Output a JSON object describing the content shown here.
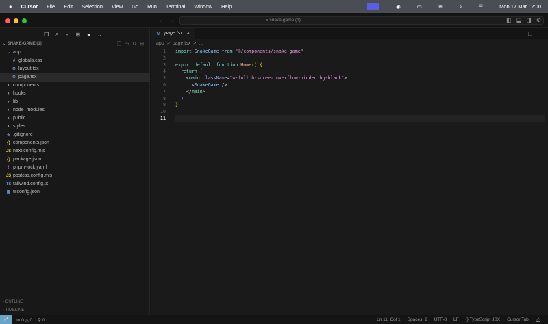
{
  "menubar": {
    "app": "Cursor",
    "items": [
      "File",
      "Edit",
      "Selection",
      "View",
      "Go",
      "Run",
      "Terminal",
      "Window",
      "Help"
    ],
    "datetime": "Mon 17 Mar  12:00"
  },
  "window": {
    "search": "snake-game (1)"
  },
  "sidebar": {
    "title": "SNAKE-GAME (1)",
    "tree": [
      {
        "label": "app",
        "icon": "⌄",
        "indent": 1
      },
      {
        "label": "globals.css",
        "icon": "#",
        "indent": 2,
        "color": "#7fa4d0"
      },
      {
        "label": "layout.tsx",
        "icon": "⚙",
        "indent": 2,
        "color": "#6b8fb8"
      },
      {
        "label": "page.tsx",
        "icon": "⚙",
        "indent": 2,
        "color": "#6b8fb8",
        "selected": true
      },
      {
        "label": "components",
        "icon": "›",
        "indent": 1
      },
      {
        "label": "hooks",
        "icon": "›",
        "indent": 1
      },
      {
        "label": "lib",
        "icon": "›",
        "indent": 1
      },
      {
        "label": "node_modules",
        "icon": "›",
        "indent": 1
      },
      {
        "label": "public",
        "icon": "›",
        "indent": 1
      },
      {
        "label": "styles",
        "icon": "›",
        "indent": 1
      },
      {
        "label": ".gitignore",
        "icon": "◈",
        "indent": 1,
        "color": "#6b7c8f"
      },
      {
        "label": "components.json",
        "icon": "{}",
        "indent": 1,
        "color": "#d6c94a"
      },
      {
        "label": "next.config.mjs",
        "icon": "JS",
        "indent": 1,
        "color": "#d6c94a"
      },
      {
        "label": "package.json",
        "icon": "{}",
        "indent": 1,
        "color": "#d6c94a"
      },
      {
        "label": "pnpm-lock.yaml",
        "icon": "!",
        "indent": 1,
        "color": "#a074c4"
      },
      {
        "label": "postcss.config.mjs",
        "icon": "JS",
        "indent": 1,
        "color": "#d6c94a"
      },
      {
        "label": "tailwind.config.ts",
        "icon": "TS",
        "indent": 1,
        "color": "#5a8fc8"
      },
      {
        "label": "tsconfig.json",
        "icon": "▦",
        "indent": 1,
        "color": "#5a8fc8"
      }
    ],
    "outline": "OUTLINE",
    "timeline": "TIMELINE"
  },
  "editor": {
    "tab": "page.tsx",
    "breadcrumb": [
      "app",
      ">",
      "page.tsx",
      ">",
      "..."
    ],
    "lines": [
      "<span class='kw'>import</span> <span class='tg'>SnakeGame</span> <span class='kw'>from</span> <span class='st'>\"@/components/snake-game\"</span>",
      "",
      "<span class='kw'>export default function</span> <span class='fn'>Home</span><span class='y'>()</span> <span class='y'>{</span>",
      "  <span class='kw'>return</span> <span class='at'>(</span>",
      "    <span class='pn'>&lt;</span><span class='kw'>main</span> <span class='at'>className</span>=<span class='st'>\"w-full h-screen overflow-hidden bg-black\"</span><span class='pn'>&gt;</span>",
      "      <span class='pn'>&lt;</span><span class='tg'>SnakeGame</span> <span class='pn'>/&gt;</span>",
      "    <span class='pn'>&lt;/</span><span class='kw'>main</span><span class='pn'>&gt;</span>",
      "  <span class='at'>)</span>",
      "<span class='y'>}</span>",
      "",
      ""
    ]
  },
  "status": {
    "errors": "0",
    "warnings": "0",
    "ports": "0",
    "position": "Ln 11, Col 1",
    "spaces": "Spaces: 2",
    "encoding": "UTF-8",
    "eol": "LF",
    "language": "TypeScript JSX",
    "tab": "Cursor Tab"
  }
}
